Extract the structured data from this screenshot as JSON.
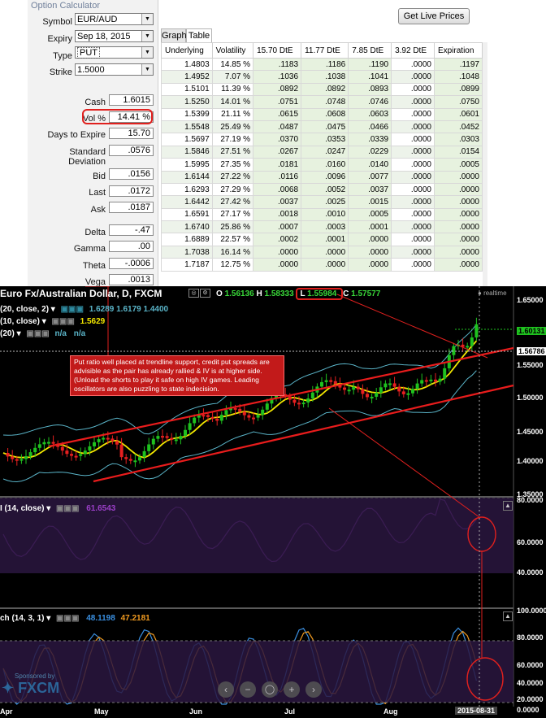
{
  "calculator": {
    "panel_title": "Option Calculator",
    "symbol": {
      "label": "Symbol",
      "value": "EUR/AUD"
    },
    "expiry": {
      "label": "Expiry",
      "value": "Sep 18, 2015"
    },
    "type": {
      "label": "Type",
      "value": "PUT"
    },
    "strike": {
      "label": "Strike",
      "value": "1.5000"
    },
    "cash": {
      "label": "Cash",
      "value": "1.6015"
    },
    "vol": {
      "label": "Vol %",
      "value": "14.41 %"
    },
    "days_to_expire": {
      "label": "Days to Expire",
      "value": "15.70"
    },
    "std_dev": {
      "label": "Standard Deviation",
      "value": ".0576"
    },
    "bid": {
      "label": "Bid",
      "value": ".0156"
    },
    "last": {
      "label": "Last",
      "value": ".0172"
    },
    "ask": {
      "label": "Ask",
      "value": ".0187"
    },
    "delta": {
      "label": "Delta",
      "value": "-.47"
    },
    "gamma": {
      "label": "Gamma",
      "value": ".00"
    },
    "theta": {
      "label": "Theta",
      "value": "-.0006"
    },
    "vega": {
      "label": "Vega",
      "value": ".0013"
    },
    "get_live_prices": "Get Live Prices",
    "tabs": [
      "Graph",
      "Table"
    ],
    "table": {
      "headers": [
        "Underlying",
        "Volatility",
        "15.70 DtE",
        "11.77 DtE",
        "7.85 DtE",
        "3.92 DtE",
        "Expiration"
      ],
      "rows": [
        [
          "1.4803",
          "14.85 %",
          ".1183",
          ".1186",
          ".1190",
          ".0000",
          ".1197"
        ],
        [
          "1.4952",
          "7.07 %",
          ".1036",
          ".1038",
          ".1041",
          ".0000",
          ".1048"
        ],
        [
          "1.5101",
          "11.39 %",
          ".0892",
          ".0892",
          ".0893",
          ".0000",
          ".0899"
        ],
        [
          "1.5250",
          "14.01 %",
          ".0751",
          ".0748",
          ".0746",
          ".0000",
          ".0750"
        ],
        [
          "1.5399",
          "21.11 %",
          ".0615",
          ".0608",
          ".0603",
          ".0000",
          ".0601"
        ],
        [
          "1.5548",
          "25.49 %",
          ".0487",
          ".0475",
          ".0466",
          ".0000",
          ".0452"
        ],
        [
          "1.5697",
          "27.19 %",
          ".0370",
          ".0353",
          ".0339",
          ".0000",
          ".0303"
        ],
        [
          "1.5846",
          "27.51 %",
          ".0267",
          ".0247",
          ".0229",
          ".0000",
          ".0154"
        ],
        [
          "1.5995",
          "27.35 %",
          ".0181",
          ".0160",
          ".0140",
          ".0000",
          ".0005"
        ],
        [
          "1.6144",
          "27.22 %",
          ".0116",
          ".0096",
          ".0077",
          ".0000",
          ".0000"
        ],
        [
          "1.6293",
          "27.29 %",
          ".0068",
          ".0052",
          ".0037",
          ".0000",
          ".0000"
        ],
        [
          "1.6442",
          "27.42 %",
          ".0037",
          ".0025",
          ".0015",
          ".0000",
          ".0000"
        ],
        [
          "1.6591",
          "27.17 %",
          ".0018",
          ".0010",
          ".0005",
          ".0000",
          ".0000"
        ],
        [
          "1.6740",
          "25.86 %",
          ".0007",
          ".0003",
          ".0001",
          ".0000",
          ".0000"
        ],
        [
          "1.6889",
          "22.57 %",
          ".0002",
          ".0001",
          ".0000",
          ".0000",
          ".0000"
        ],
        [
          "1.7038",
          "16.14 %",
          ".0000",
          ".0000",
          ".0000",
          ".0000",
          ".0000"
        ],
        [
          "1.7187",
          "12.75 %",
          ".0000",
          ".0000",
          ".0000",
          ".0000",
          ".0000"
        ]
      ]
    }
  },
  "chart": {
    "title": "Euro Fx/Australian Dollar, D, FXCM",
    "ohlc": {
      "o_label": "O",
      "o": "1.56136",
      "h_label": "H",
      "h": "1.58333",
      "l_label": "L",
      "l": "1.55984",
      "c_label": "C",
      "c": "1.57577"
    },
    "realtime": "realtime",
    "ind1": {
      "label": "(20, close, 2)",
      "v1": "1.6289",
      "v2": "1.6179",
      "v3": "1.4400"
    },
    "ind2": {
      "label": "(10, close)",
      "v1": "1.5629"
    },
    "ind3": {
      "label": "(20)",
      "v1": "n/a",
      "v2": "n/a"
    },
    "annotation": "Put ratio well placed at trendline support, credit put spreads are advisible as the pair has already rallied & IV is at higher side. (Unload the shorts to play it safe on high IV games. Leading oscillators are also puzzling to state indecision.",
    "price_axis": [
      "1.65000",
      "1.60131",
      "1.56786",
      "1.55000",
      "1.50000",
      "1.45000",
      "1.40000",
      "1.35000"
    ],
    "last_price_tag": "1.60131",
    "support_tag": "1.56786",
    "rsi": {
      "label": "I (14, close)",
      "value": "61.6543",
      "axis": [
        "80.0000",
        "60.0000",
        "40.0000"
      ]
    },
    "stoch": {
      "label": "ch (14, 3, 1)",
      "v1": "48.1198",
      "v2": "47.2181",
      "axis": [
        "100.0000",
        "80.0000",
        "60.0000",
        "40.0000",
        "20.0000",
        "0.0000"
      ]
    },
    "x_axis": [
      "Apr",
      "May",
      "Jun",
      "Jul",
      "Aug",
      "2015-08-31"
    ],
    "watermark_top": "Sponsored by",
    "watermark": "FXCM",
    "colors": {
      "up": "#1fc21f",
      "down": "#e82020",
      "trend": "#e81c1c",
      "bollinger": "#5ab4c8",
      "ma": "#f2e600",
      "rsi": "#9b3fc8",
      "stoch_k": "#3a8fe0",
      "stoch_d": "#f09a20",
      "annot_bg": "#c21a1a"
    }
  }
}
